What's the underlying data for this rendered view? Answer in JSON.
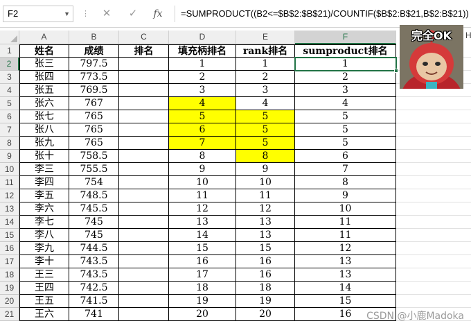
{
  "formula_bar": {
    "name_box": "F2",
    "cancel_symbol": "✕",
    "enter_symbol": "✓",
    "fx_label": "fx",
    "formula": "=SUMPRODUCT((B2<=$B$2:$B$21)/COUNTIF($B$2:B$21,B$2:B$21))"
  },
  "sheet": {
    "columns": [
      "A",
      "B",
      "C",
      "D",
      "E",
      "F"
    ],
    "extra_column": "H",
    "selected_cell": "F2",
    "header_row": [
      "姓名",
      "成绩",
      "排名",
      "填充柄排名",
      "rank排名",
      "sumproduct排名"
    ],
    "rows": [
      [
        "张三",
        "797.5",
        "",
        "1",
        "1",
        "1"
      ],
      [
        "张四",
        "773.5",
        "",
        "2",
        "2",
        "2"
      ],
      [
        "张五",
        "769.5",
        "",
        "3",
        "3",
        "3"
      ],
      [
        "张六",
        "767",
        "",
        "4",
        "4",
        "4"
      ],
      [
        "张七",
        "765",
        "",
        "5",
        "5",
        "5"
      ],
      [
        "张八",
        "765",
        "",
        "6",
        "5",
        "5"
      ],
      [
        "张九",
        "765",
        "",
        "7",
        "5",
        "5"
      ],
      [
        "张十",
        "758.5",
        "",
        "8",
        "8",
        "6"
      ],
      [
        "李三",
        "755.5",
        "",
        "9",
        "9",
        "7"
      ],
      [
        "李四",
        "754",
        "",
        "10",
        "10",
        "8"
      ],
      [
        "李五",
        "748.5",
        "",
        "11",
        "11",
        "9"
      ],
      [
        "李六",
        "745.5",
        "",
        "12",
        "12",
        "10"
      ],
      [
        "李七",
        "745",
        "",
        "13",
        "13",
        "11"
      ],
      [
        "李八",
        "745",
        "",
        "14",
        "13",
        "11"
      ],
      [
        "李九",
        "744.5",
        "",
        "15",
        "15",
        "12"
      ],
      [
        "李十",
        "743.5",
        "",
        "16",
        "16",
        "13"
      ],
      [
        "王三",
        "743.5",
        "",
        "17",
        "16",
        "13"
      ],
      [
        "王四",
        "742.5",
        "",
        "18",
        "18",
        "14"
      ],
      [
        "王五",
        "741.5",
        "",
        "19",
        "19",
        "15"
      ],
      [
        "王六",
        "741",
        "",
        "20",
        "20",
        "16"
      ]
    ],
    "highlight_color": "#ffff00",
    "highlighted_cells": [
      "D5",
      "D6",
      "D7",
      "D8",
      "E6",
      "E7",
      "E8",
      "E9"
    ]
  },
  "sticker": {
    "caption": "完全OK"
  },
  "watermark": "CSDN @小鹿Madoka"
}
